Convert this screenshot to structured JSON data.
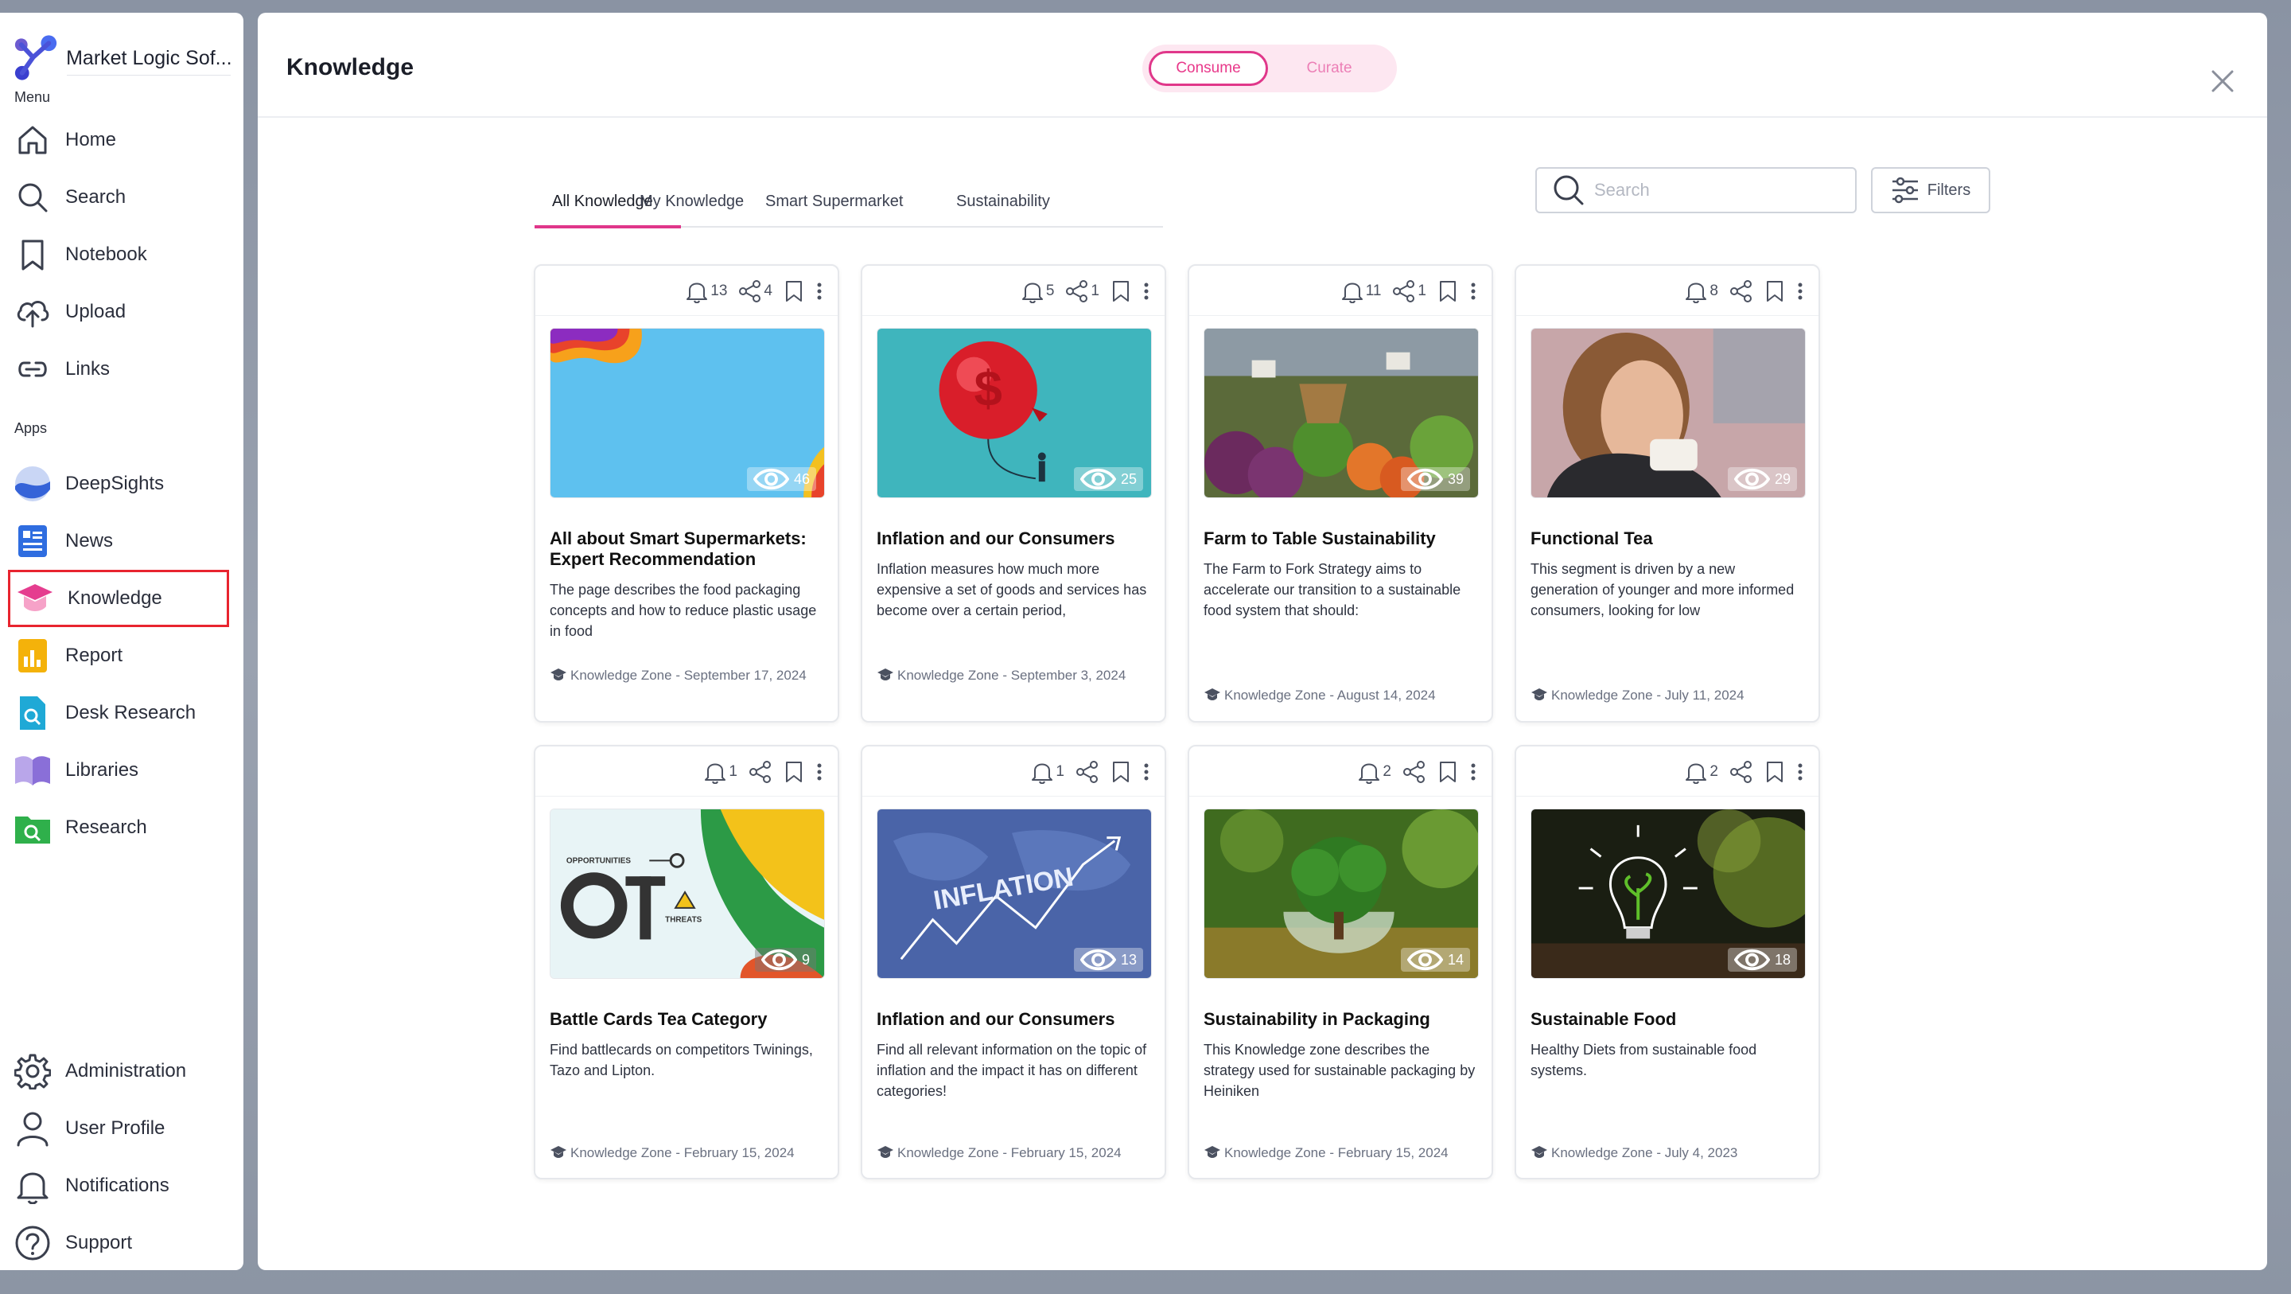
{
  "sidebar": {
    "brand": "Market Logic Sof...",
    "menu_label": "Menu",
    "apps_label": "Apps",
    "menu": [
      {
        "label": "Home",
        "icon": "home-icon"
      },
      {
        "label": "Search",
        "icon": "search-icon"
      },
      {
        "label": "Notebook",
        "icon": "bookmark-icon"
      },
      {
        "label": "Upload",
        "icon": "upload-icon"
      },
      {
        "label": "Links",
        "icon": "link-icon"
      }
    ],
    "apps": [
      {
        "label": "DeepSights",
        "icon": "deepsights-icon"
      },
      {
        "label": "News",
        "icon": "news-icon"
      },
      {
        "label": "Knowledge",
        "icon": "knowledge-icon",
        "active": true
      },
      {
        "label": "Report",
        "icon": "report-icon"
      },
      {
        "label": "Desk Research",
        "icon": "desk-research-icon"
      },
      {
        "label": "Libraries",
        "icon": "libraries-icon"
      },
      {
        "label": "Research",
        "icon": "research-icon"
      }
    ],
    "bottom": [
      {
        "label": "Administration",
        "icon": "gear-icon"
      },
      {
        "label": "User Profile",
        "icon": "user-icon"
      },
      {
        "label": "Notifications",
        "icon": "bell-icon"
      },
      {
        "label": "Support",
        "icon": "help-icon"
      }
    ]
  },
  "header": {
    "title": "Knowledge",
    "toggle": {
      "consume": "Consume",
      "curate": "Curate"
    }
  },
  "tabs": [
    "All Knowledge",
    "My Knowledge",
    "Smart Supermarket",
    "Sustainability"
  ],
  "search": {
    "placeholder": "Search"
  },
  "filters_label": "Filters",
  "colors": {
    "accent": "#e0378a",
    "active_border": "#e8242f"
  },
  "cards": [
    {
      "bell": "13",
      "share": "4",
      "views": "46",
      "title": "All about Smart Supermarkets: Expert Recommendation",
      "desc": "The page describes the food packaging concepts and how to reduce plastic usage in food",
      "footer": "Knowledge Zone - September 17, 2024"
    },
    {
      "bell": "5",
      "share": "1",
      "views": "25",
      "title": "Inflation and our Consumers",
      "desc": "Inflation measures how much more expensive a set of goods and services has become over a certain period,",
      "footer": "Knowledge Zone - September 3, 2024"
    },
    {
      "bell": "11",
      "share": "1",
      "views": "39",
      "title": "Farm to Table Sustainability",
      "desc": "The Farm to Fork Strategy aims to accelerate our transition to a sustainable food system that should:",
      "footer": "Knowledge Zone - August 14, 2024"
    },
    {
      "bell": "8",
      "share": "",
      "views": "29",
      "title": "Functional Tea",
      "desc": "This segment is driven by a new generation of younger and more informed consumers, looking for low",
      "footer": "Knowledge Zone - July 11, 2024"
    },
    {
      "bell": "1",
      "share": "",
      "views": "9",
      "title": "Battle Cards Tea Category",
      "desc": "Find battlecards on competitors Twinings, Tazo and Lipton.",
      "footer": "Knowledge Zone - February 15, 2024"
    },
    {
      "bell": "1",
      "share": "",
      "views": "13",
      "title": "Inflation and our Consumers",
      "desc": "Find all relevant information on the topic of inflation and the impact it has on different categories!",
      "footer": "Knowledge Zone - February 15, 2024"
    },
    {
      "bell": "2",
      "share": "",
      "views": "14",
      "title": "Sustainability in Packaging",
      "desc": "This Knowledge zone describes the strategy used for sustainable packaging by Heiniken",
      "footer": "Knowledge Zone - February 15, 2024"
    },
    {
      "bell": "2",
      "share": "",
      "views": "18",
      "title": "Sustainable Food",
      "desc": "Healthy Diets from sustainable food systems.",
      "footer": "Knowledge Zone - July 4, 2023"
    }
  ],
  "thumb_text": {
    "opportunities": "OPPORTUNITIES",
    "threats": "THREATS",
    "inflation": "INFLATION"
  }
}
